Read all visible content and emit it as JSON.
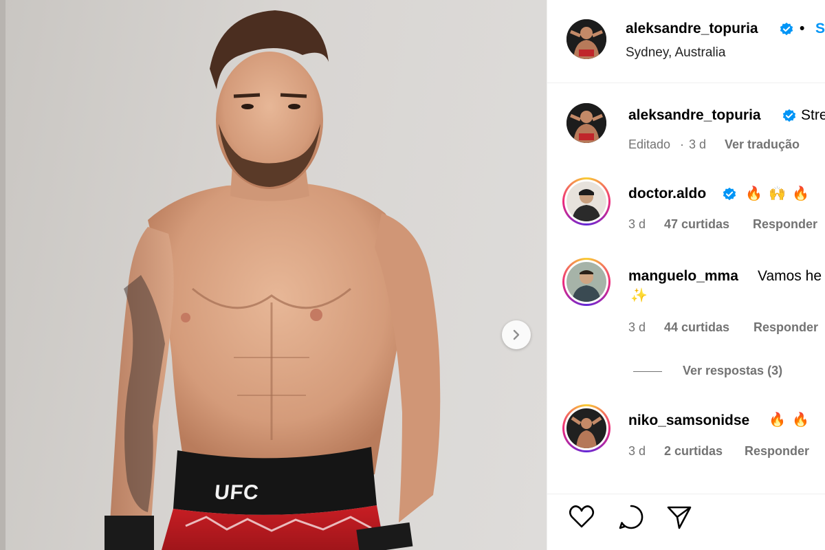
{
  "media": {
    "brand_on_shorts": "UFC",
    "next_button_icon": "chevron-right-icon"
  },
  "post_header": {
    "username": "aleksandre_topuria",
    "separator": "•",
    "follow_label": "Se",
    "location": "Sydney, Australia"
  },
  "caption": {
    "username": "aleksandre_topuria",
    "text": "Stre",
    "edited": "Editado",
    "sep": "·",
    "time": "3 d",
    "translate": "Ver tradução"
  },
  "comments": [
    {
      "username": "doctor.aldo",
      "verified": true,
      "text": "",
      "emojis": [
        "🔥",
        "🙌",
        "🔥"
      ],
      "time": "3 d",
      "likes": "47 curtidas",
      "reply": "Responder"
    },
    {
      "username": "manguelo_mma",
      "verified": false,
      "text": "Vamos he",
      "emojis": [
        "✨"
      ],
      "time": "3 d",
      "likes": "44 curtidas",
      "reply": "Responder",
      "view_replies": "Ver respostas (3)"
    },
    {
      "username": "niko_samsonidse",
      "verified": false,
      "text": "",
      "emojis": [
        "🔥",
        "🔥"
      ],
      "time": "3 d",
      "likes": "2 curtidas",
      "reply": "Responder"
    }
  ],
  "actions": {
    "like_icon": "heart-icon",
    "comment_icon": "comment-icon",
    "share_icon": "send-icon"
  },
  "colors": {
    "accent": "#0095f6",
    "verified": "#0095f6",
    "muted": "#737373"
  }
}
